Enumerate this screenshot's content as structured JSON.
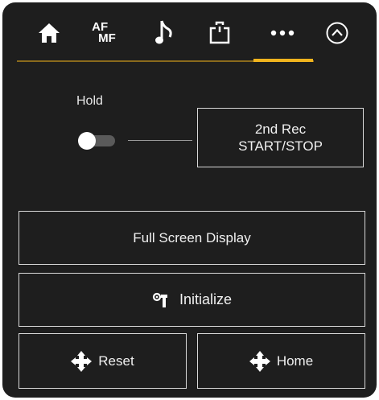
{
  "tabs": [
    {
      "icon": "home-icon"
    },
    {
      "label_top": "AF",
      "label_bottom": "MF"
    },
    {
      "icon": "music-note-icon"
    },
    {
      "icon": "camera-mount-icon"
    },
    {
      "icon": "more-dots-icon",
      "active": true
    },
    {
      "icon": "collapse-chevron-icon"
    }
  ],
  "hold": {
    "label": "Hold",
    "toggle_state": "off"
  },
  "buttons": {
    "second_rec_line1": "2nd Rec",
    "second_rec_line2": "START/STOP",
    "full_screen": "Full Screen Display",
    "initialize": "Initialize",
    "reset": "Reset",
    "home": "Home"
  },
  "colors": {
    "background": "#1e1e1e",
    "accent": "#f0b41e",
    "tab_underline": "#8a6a1c",
    "border": "#d8d8d8"
  }
}
